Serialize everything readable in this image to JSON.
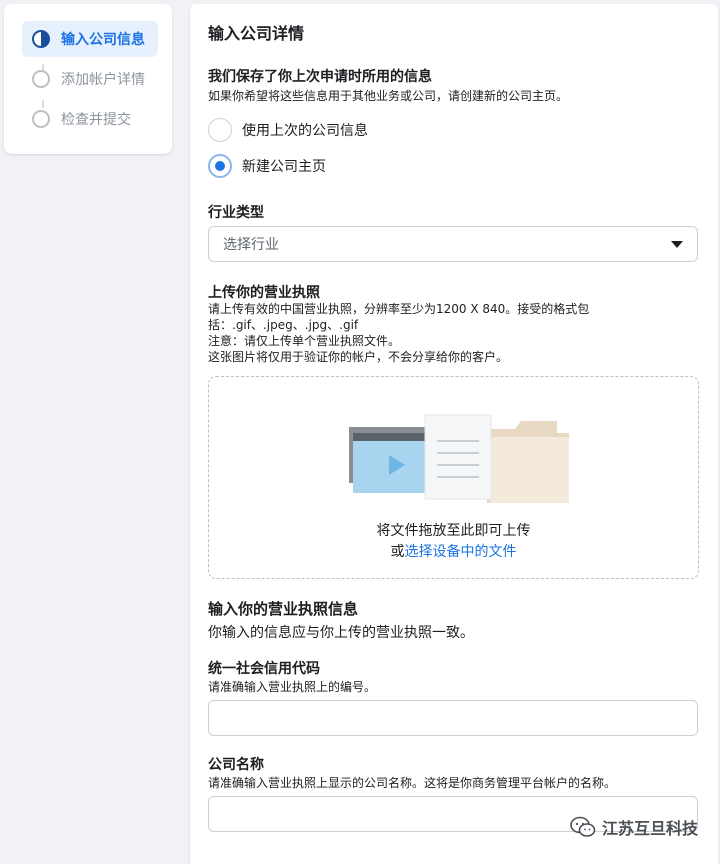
{
  "steps": [
    {
      "label": "输入公司信息",
      "active": true
    },
    {
      "label": "添加帐户详情",
      "active": false
    },
    {
      "label": "检查并提交",
      "active": false
    }
  ],
  "form": {
    "title": "输入公司详情",
    "saved_info": {
      "heading": "我们保存了你上次申请时所用的信息",
      "note": "如果你希望将这些信息用于其他业务或公司，请创建新的公司主页。",
      "options": [
        {
          "label": "使用上次的公司信息",
          "checked": false
        },
        {
          "label": "新建公司主页",
          "checked": true
        }
      ]
    },
    "industry": {
      "label": "行业类型",
      "placeholder": "选择行业"
    },
    "license_upload": {
      "heading": "上传你的营业执照",
      "desc_line1": "请上传有效的中国营业执照，分辨率至少为1200 X 840。接受的格式包",
      "desc_line2": "括：.gif、.jpeg、.jpg、.gif",
      "desc_line3": "注意：请仅上传单个营业执照文件。",
      "desc_line4": "这张图片将仅用于验证你的帐户，不会分享给你的客户。",
      "drop_text": "将文件拖放至此即可上传",
      "or_text": "或",
      "choose_link": "选择设备中的文件"
    },
    "license_info": {
      "heading": "输入你的营业执照信息",
      "desc": "你输入的信息应与你上传的营业执照一致。"
    },
    "credit_code": {
      "label": "统一社会信用代码",
      "hint": "请准确输入营业执照上的编号。"
    },
    "company_name": {
      "label": "公司名称",
      "hint": "请准确输入营业执照上显示的公司名称。这将是你商务管理平台帐户的名称。"
    }
  },
  "watermark": {
    "text": "江苏互旦科技"
  },
  "colors": {
    "accent": "#1b74e4",
    "background": "#f0f2f5"
  }
}
